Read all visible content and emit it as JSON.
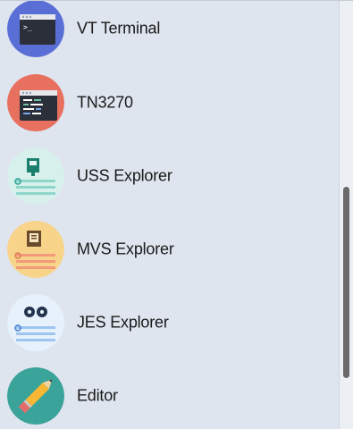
{
  "apps": [
    {
      "label": "VT Terminal",
      "icon": "vt-terminal-icon",
      "color": "#5a6fd6"
    },
    {
      "label": "TN3270",
      "icon": "tn3270-icon",
      "color": "#e8705f"
    },
    {
      "label": "USS Explorer",
      "icon": "uss-explorer-icon",
      "color": "#d7f0ec"
    },
    {
      "label": "MVS Explorer",
      "icon": "mvs-explorer-icon",
      "color": "#f7d48a"
    },
    {
      "label": "JES Explorer",
      "icon": "jes-explorer-icon",
      "color": "#e6f1fb"
    },
    {
      "label": "Editor",
      "icon": "pencil-icon",
      "color": "#3aa39a"
    }
  ],
  "scrollbar": {
    "position": 0.45,
    "visible_fraction": 0.45
  }
}
